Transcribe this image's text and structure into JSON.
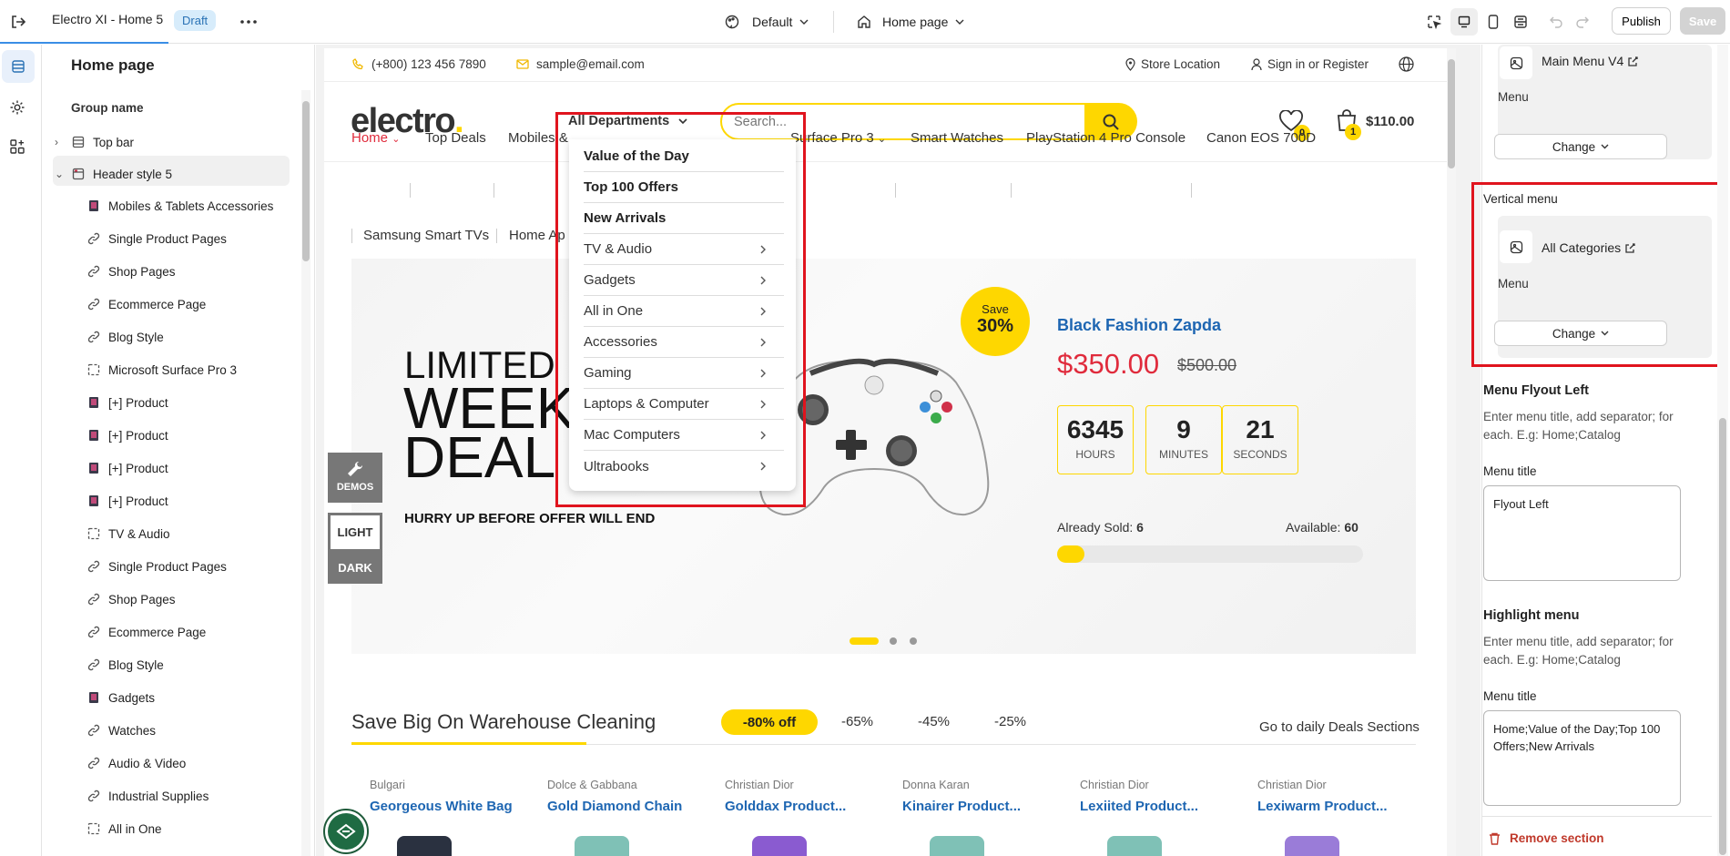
{
  "topbar": {
    "title": "Electro XI - Home 5",
    "badge": "Draft",
    "theme_select": "Default",
    "page_select": "Home page",
    "publish": "Publish",
    "save": "Save"
  },
  "sidebar": {
    "heading": "Home page",
    "group_name": "Group name",
    "items": [
      {
        "label": "Top bar",
        "icon": "layout-icon"
      },
      {
        "label": "Header style 5",
        "icon": "header-icon"
      },
      {
        "label": "Mobiles & Tablets Accessories",
        "icon": "image-icon"
      },
      {
        "label": "Single Product Pages",
        "icon": "link-icon"
      },
      {
        "label": "Shop Pages",
        "icon": "link-icon"
      },
      {
        "label": "Ecommerce Page",
        "icon": "link-icon"
      },
      {
        "label": "Blog Style",
        "icon": "link-icon"
      },
      {
        "label": "Microsoft Surface Pro 3",
        "icon": "frame-icon"
      },
      {
        "label": "[+] Product",
        "icon": "image-icon"
      },
      {
        "label": "[+] Product",
        "icon": "image-icon"
      },
      {
        "label": "[+] Product",
        "icon": "image-icon"
      },
      {
        "label": "[+] Product",
        "icon": "image-icon"
      },
      {
        "label": "TV & Audio",
        "icon": "frame-icon"
      },
      {
        "label": "Single Product Pages",
        "icon": "link-icon"
      },
      {
        "label": "Shop Pages",
        "icon": "link-icon"
      },
      {
        "label": "Ecommerce Page",
        "icon": "link-icon"
      },
      {
        "label": "Blog Style",
        "icon": "link-icon"
      },
      {
        "label": "Gadgets",
        "icon": "image-icon"
      },
      {
        "label": "Watches",
        "icon": "link-icon"
      },
      {
        "label": "Audio & Video",
        "icon": "link-icon"
      },
      {
        "label": "Industrial Supplies",
        "icon": "link-icon"
      },
      {
        "label": "All in One",
        "icon": "frame-icon"
      }
    ]
  },
  "store": {
    "phone": "(+800) 123 456 7890",
    "email": "sample@email.com",
    "store_location": "Store Location",
    "sign_in": "Sign in or Register",
    "logo": "electro",
    "logo_dot": ".",
    "departments": "All Departments",
    "search_placeholder": "Search...",
    "wishlist_count": "0",
    "cart_count": "1",
    "cart_total": "$110.00",
    "nav_row1": [
      "Home",
      "Top Deals",
      "Mobiles &",
      "Surface Pro 3",
      "Smart Watches",
      "PlayStation 4 Pro Console",
      "Canon EOS 700D"
    ],
    "nav_row2": [
      "Samsung Smart TVs",
      "Home Ap"
    ],
    "dropdown": [
      {
        "label": "Value of the Day",
        "bold": true
      },
      {
        "label": "Top 100 Offers",
        "bold": true
      },
      {
        "label": "New Arrivals",
        "bold": true
      },
      {
        "label": "TV & Audio",
        "bold": false
      },
      {
        "label": "Gadgets",
        "bold": false
      },
      {
        "label": "All in One",
        "bold": false
      },
      {
        "label": "Accessories",
        "bold": false
      },
      {
        "label": "Gaming",
        "bold": false
      },
      {
        "label": "Laptops & Computer",
        "bold": false
      },
      {
        "label": "Mac Computers",
        "bold": false
      },
      {
        "label": "Ultrabooks",
        "bold": false
      }
    ],
    "hero": {
      "line1": "LIMITED",
      "line2": "WEEK",
      "line3": "DEAL",
      "subline": "HURRY UP BEFORE OFFER WILL END",
      "save_label": "Save",
      "save_value": "30%",
      "product_name": "Black Fashion Zapda",
      "price": "$350.00",
      "old_price": "$500.00",
      "timers": [
        {
          "value": "6345",
          "label": "HOURS"
        },
        {
          "value": "9",
          "label": "MINUTES"
        },
        {
          "value": "21",
          "label": "SECONDS"
        }
      ],
      "sold_label": "Already Sold:",
      "sold_value": "6",
      "available_label": "Available:",
      "available_value": "60",
      "sold_fraction": 0.09,
      "demos": "DEMOS",
      "light": "LIGHT",
      "dark": "DARK"
    },
    "deals": {
      "title": "Save Big On Warehouse Cleaning",
      "tabs": [
        "-80% off",
        "-65%",
        "-45%",
        "-25%"
      ],
      "go_link": "Go to daily Deals Sections",
      "products": [
        {
          "brand": "Bulgari",
          "name": "Georgeous White Bag"
        },
        {
          "brand": "Dolce & Gabbana",
          "name": "Gold Diamond Chain"
        },
        {
          "brand": "Christian Dior",
          "name": "Golddax Product..."
        },
        {
          "brand": "Donna Karan",
          "name": "Kinairer Product..."
        },
        {
          "brand": "Christian Dior",
          "name": "Lexiited Product..."
        },
        {
          "brand": "Christian Dior",
          "name": "Lexiwarm Product..."
        }
      ]
    }
  },
  "panel": {
    "main_menu_name": "Main Menu V4",
    "menu_label": "Menu",
    "change": "Change",
    "vertical_menu": "Vertical menu",
    "vertical_menu_name": "All Categories",
    "flyout_title": "Menu Flyout Left",
    "flyout_help": "Enter menu title, add separator; for each. E.g: Home;Catalog",
    "menu_title_label": "Menu title",
    "flyout_value": "Flyout Left",
    "highlight_title": "Highlight menu",
    "highlight_help": "Enter menu title, add separator; for each. E.g: Home;Catalog",
    "highlight_value": "Home;Value of the Day;Top 100 Offers;New Arrivals",
    "remove_section": "Remove section"
  },
  "colors": {
    "accent": "#fed700",
    "link_blue": "#1e66b2",
    "price_red": "#e02b3c",
    "highlight_red": "#e0141e"
  }
}
